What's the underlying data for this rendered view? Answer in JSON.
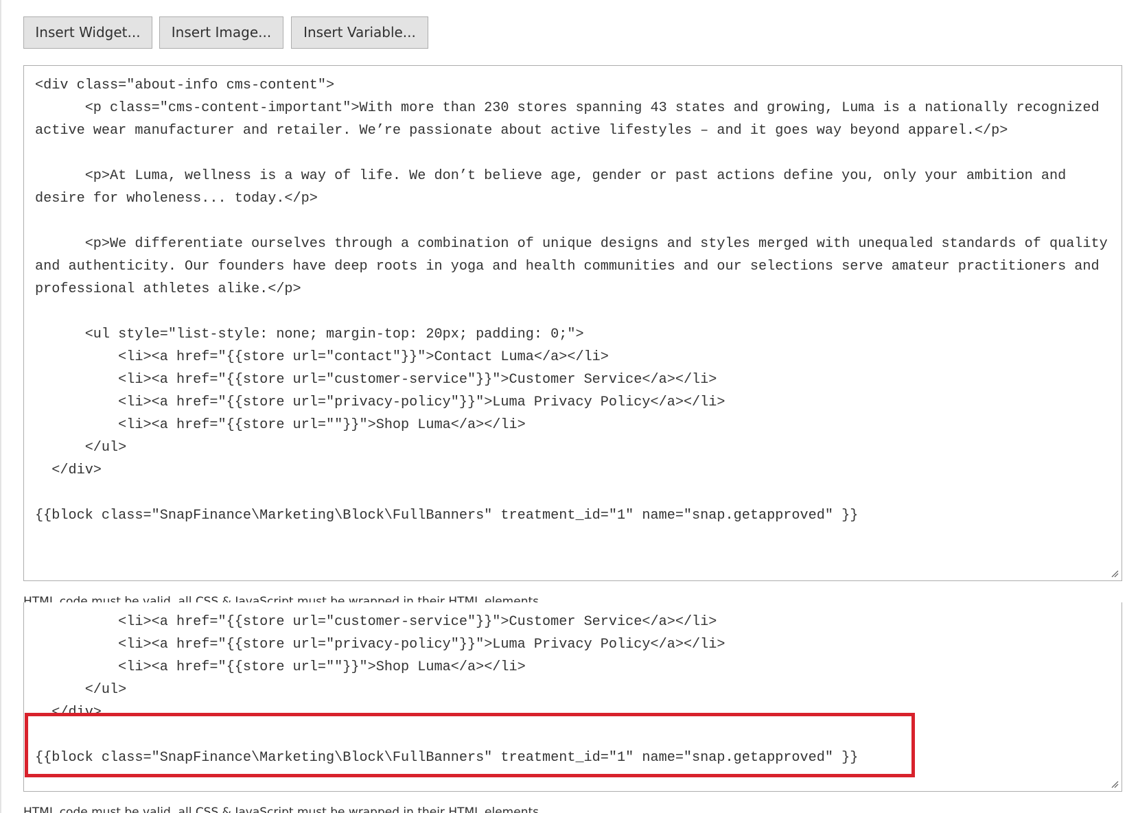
{
  "toolbar": {
    "insert_widget": "Insert Widget...",
    "insert_image": "Insert Image...",
    "insert_variable": "Insert Variable..."
  },
  "editor": {
    "content": "<div class=\"about-info cms-content\">\n      <p class=\"cms-content-important\">With more than 230 stores spanning 43 states and growing, Luma is a nationally recognized active wear manufacturer and retailer. We’re passionate about active lifestyles – and it goes way beyond apparel.</p>\n\n      <p>At Luma, wellness is a way of life. We don’t believe age, gender or past actions define you, only your ambition and desire for wholeness... today.</p>\n\n      <p>We differentiate ourselves through a combination of unique designs and styles merged with unequaled standards of quality and authenticity. Our founders have deep roots in yoga and health communities and our selections serve amateur practitioners and professional athletes alike.</p>\n\n      <ul style=\"list-style: none; margin-top: 20px; padding: 0;\">\n          <li><a href=\"{{store url=\"contact\"}}\">Contact Luma</a></li>\n          <li><a href=\"{{store url=\"customer-service\"}}\">Customer Service</a></li>\n          <li><a href=\"{{store url=\"privacy-policy\"}}\">Luma Privacy Policy</a></li>\n          <li><a href=\"{{store url=\"\"}}\">Shop Luma</a></li>\n      </ul>\n  </div>\n\n{{block class=\"SnapFinance\\Marketing\\Block\\FullBanners\" treatment_id=\"1\" name=\"snap.getapproved\" }}",
    "content_scrolled": "\n          <li><a href=\"{{store url=\"customer-service\"}}\">Customer Service</a></li>\n          <li><a href=\"{{store url=\"privacy-policy\"}}\">Luma Privacy Policy</a></li>\n          <li><a href=\"{{store url=\"\"}}\">Shop Luma</a></li>\n      </ul>\n  </div>\n\n{{block class=\"SnapFinance\\Marketing\\Block\\FullBanners\" treatment_id=\"1\" name=\"snap.getapproved\" }}"
  },
  "note": "HTML code must be valid, all CSS & JavaScript must be wrapped in their HTML elements.",
  "colors": {
    "button_bg": "#e3e3e3",
    "border": "#adadad",
    "highlight": "#d8222c"
  }
}
